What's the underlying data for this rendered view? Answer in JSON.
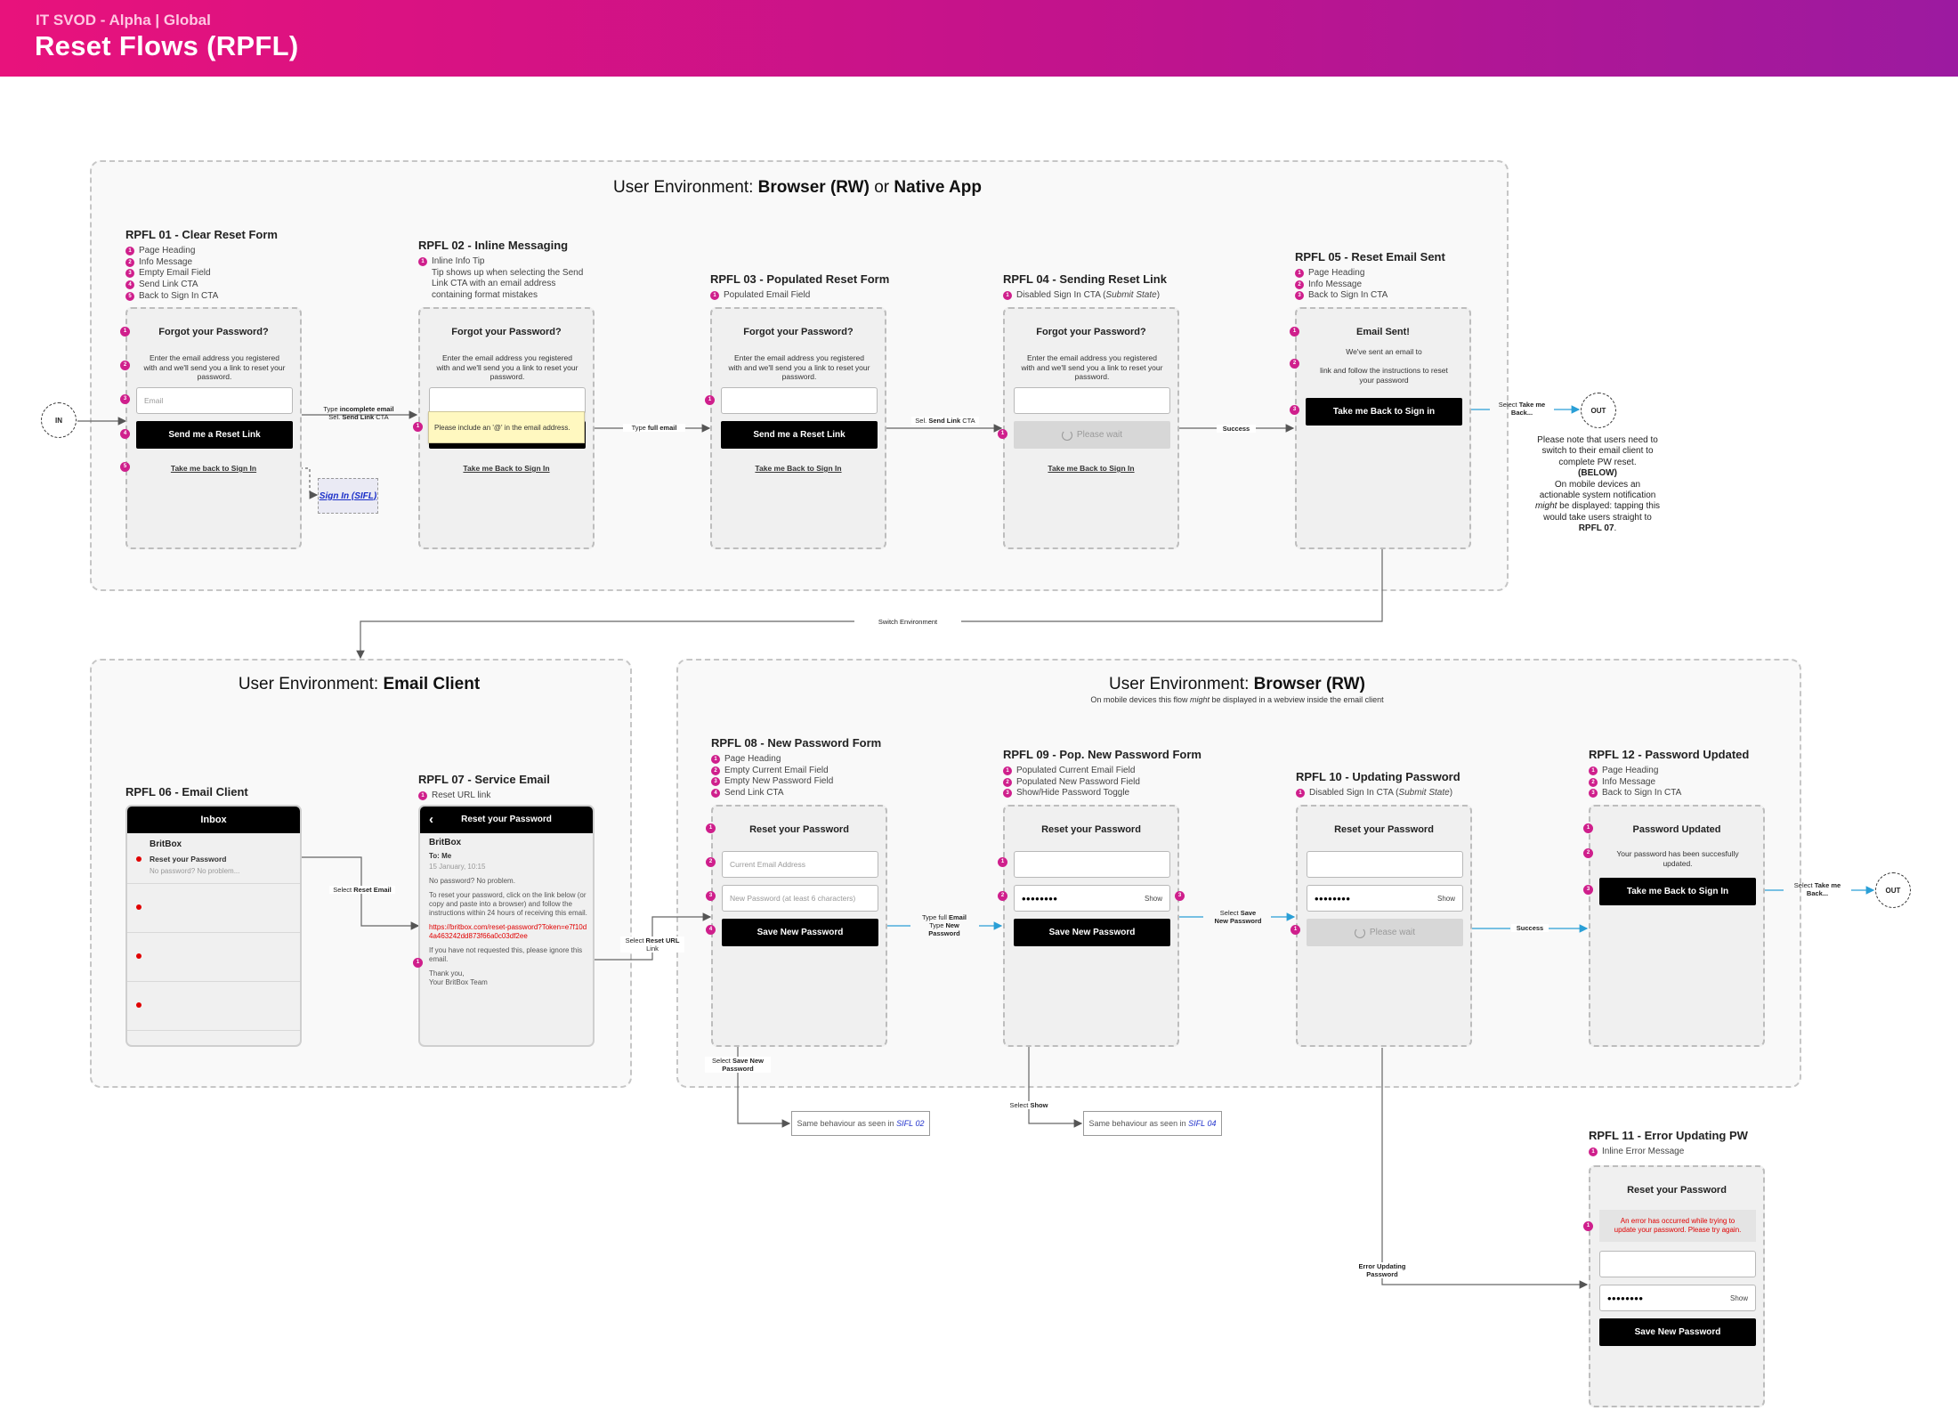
{
  "header": {
    "subtitle": "IT SVOD - Alpha | Global",
    "title": "Reset Flows (RPFL)"
  },
  "env1": {
    "pre": "User Environment: ",
    "b1": "Browser (RW)",
    "mid": " or ",
    "b2": "Native App"
  },
  "env2": {
    "pre": "User Environment: ",
    "b1": "Email Client"
  },
  "env3": {
    "pre": "User Environment: ",
    "b1": "Browser (RW)",
    "note_pre": "On mobile devices this flow ",
    "note_em": "might",
    "note_post": " be displayed in a webview inside the email client"
  },
  "common": {
    "forgot": "Forgot your Password?",
    "info": "Enter the email address you registered with and we'll send you a link to reset your password.",
    "send_link": "Send me a Reset Link",
    "back_link_1": "Take me back to Sign In",
    "back_link_2": "Take me Back to Sign In",
    "please_wait": "Please wait",
    "reset_pw": "Reset your Password",
    "save_pw": "Save New Password",
    "show": "Show",
    "masked": "••••••••"
  },
  "s1": {
    "title": "RPFL 01 - Clear Reset Form",
    "legend": [
      "Page Heading",
      "Info Message",
      "Empty Email Field",
      "Send Link CTA",
      "Back to Sign In CTA"
    ],
    "email_ph": "Email"
  },
  "s2": {
    "title": "RPFL 02 - Inline Messaging",
    "legend": [
      "Inline Info Tip",
      "Tip shows up when selecting the Send Link CTA with an email address containing format mistakes"
    ],
    "tip": "Please include an '@' in the email address."
  },
  "s3": {
    "title": "RPFL 03 - Populated Reset Form",
    "legend": [
      "Populated Email Field"
    ]
  },
  "s4": {
    "title": "RPFL 04 - Sending Reset Link",
    "legend_pre": "Disabled Sign In CTA (",
    "legend_em": "Submit State",
    "legend_post": ")"
  },
  "s5": {
    "title": "RPFL 05 - Reset Email Sent",
    "legend": [
      "Page Heading",
      "Info Message",
      "Back to Sign In CTA"
    ],
    "heading": "Email Sent!",
    "info1": "We've sent an email to",
    "info2": "link and follow the instructions to reset your password",
    "btn": "Take me Back to Sign in"
  },
  "s6": {
    "title": "RPFL 06 - Email Client",
    "inbox": "Inbox",
    "sender": "BritBox",
    "subject": "Reset your Password",
    "preview": "No password? No problem..."
  },
  "s7": {
    "title": "RPFL 07 - Service Email",
    "legend": [
      "Reset URL link"
    ],
    "header": "Reset your Password",
    "from": "BritBox",
    "to": "To: Me",
    "date": "15 January, 10:15",
    "p1": "No password? No problem.",
    "p2": "To reset your password, click on the link below (or copy and paste into a browser) and follow the instructions within 24 hours of receiving this email.",
    "url": "https://britbox.com/reset-password?Token=e7f10d4a463242dd873f66a0c03df2ee",
    "p3": "If you have not requested this, please ignore this email.",
    "p4": "Thank you,",
    "p5": "Your BritBox Team"
  },
  "s8": {
    "title": "RPFL 08 - New Password Form",
    "legend": [
      "Page Heading",
      "Empty Current Email Field",
      "Empty New Password Field",
      "Send Link CTA"
    ],
    "ph1": "Current Email Address",
    "ph2": "New Password (at least 6 characters)"
  },
  "s9": {
    "title": "RPFL 09 - Pop. New Password Form",
    "legend": [
      "Populated Current Email Field",
      "Populated New Password Field",
      "Show/Hide Password Toggle"
    ]
  },
  "s10": {
    "title": "RPFL 10 - Updating Password",
    "legend_pre": "Disabled Sign In CTA (",
    "legend_em": "Submit State",
    "legend_post": ")"
  },
  "s11": {
    "title": "RPFL 11 - Error Updating PW",
    "legend": [
      "Inline Error Message"
    ],
    "error": "An error has occurred while trying to update your password. Please try again."
  },
  "s12": {
    "title": "RPFL 12 - Password Updated",
    "legend": [
      "Page Heading",
      "Info Message",
      "Back to Sign In CTA"
    ],
    "heading": "Password Updated",
    "info": "Your password has been succesfully updated.",
    "btn": "Take me Back to Sign In"
  },
  "nodes": {
    "in": "IN",
    "out": "OUT",
    "sifl": "Sign In (SIFL)"
  },
  "labels": {
    "type_incomplete": [
      "Type ",
      "incomplete",
      " email",
      "Sel. ",
      "Send Link",
      " CTA"
    ],
    "type_full": [
      "Type ",
      "full email"
    ],
    "sel_send_link": [
      "Sel. ",
      "Send Link",
      " CTA"
    ],
    "success": "Success",
    "select_take_me": [
      "Select ",
      "Take me",
      " Back..."
    ],
    "switch_env": "Switch Environment",
    "select_reset_email": [
      "Select ",
      "Reset Email"
    ],
    "select_reset_url": [
      "Select ",
      "Reset URL",
      " Link"
    ],
    "type_full_email": [
      "Type full ",
      "Email",
      "Type ",
      "New",
      " Password"
    ],
    "select_save_new": [
      "Select ",
      "Save",
      " New Password"
    ],
    "select_save_new_2": [
      "Select ",
      "Save New",
      " Password"
    ],
    "select_show": [
      "Select ",
      "Show"
    ],
    "error_updating": "Error Updating Password"
  },
  "refs": {
    "pre": "Same behaviour as seen in ",
    "r1": "SIFL 02",
    "r2": "SIFL 04"
  },
  "out_note": {
    "t1": "Please note that users need to switch to their email client to complete PW reset.",
    "b1": "(BELOW)",
    "t2": "On mobile devices an actionable system notification ",
    "em": "might",
    "t3": " be displayed: tapping this would take users straight to ",
    "b2": "RPFL 07",
    "t4": "."
  },
  "colors": {
    "brand_pink": "#e8127c",
    "brand_purple": "#9c1aa0",
    "badge": "#cf1f8c",
    "arrow_blue": "#2a9fd6",
    "error_red": "#e00000"
  }
}
